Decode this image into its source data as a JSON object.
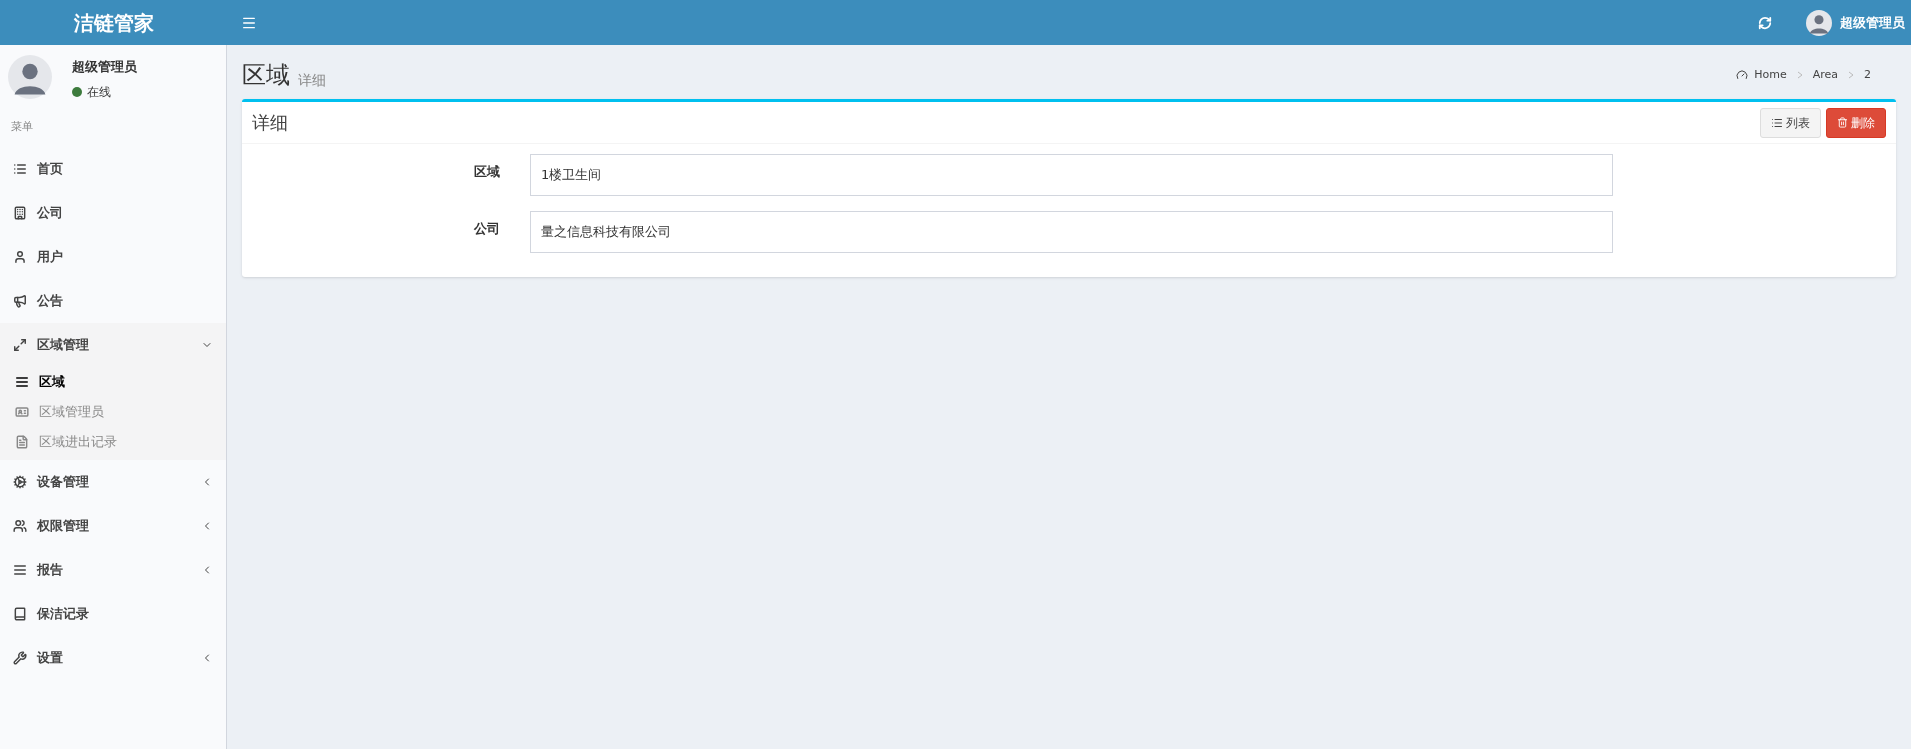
{
  "header": {
    "logo": "洁链管家",
    "user_name": "超级管理员"
  },
  "user_panel": {
    "name": "超级管理员",
    "status": "在线",
    "online": true
  },
  "sidebar": {
    "heading": "菜单",
    "items": [
      {
        "label": "首页",
        "selected": false
      },
      {
        "label": "公司",
        "selected": false
      },
      {
        "label": "用户",
        "selected": false
      },
      {
        "label": "公告",
        "selected": false
      },
      {
        "label": "区域管理",
        "selected": false,
        "expanded": true,
        "children": [
          {
            "label": "区域",
            "selected": true
          },
          {
            "label": "区域管理员",
            "selected": false
          },
          {
            "label": "区域进出记录",
            "selected": false
          }
        ]
      },
      {
        "label": "设备管理",
        "selected": false,
        "expanded": false
      },
      {
        "label": "权限管理",
        "selected": false,
        "expanded": false
      },
      {
        "label": "报告",
        "selected": false,
        "expanded": false
      },
      {
        "label": "保洁记录",
        "selected": false
      },
      {
        "label": "设置",
        "selected": false,
        "expanded": false
      }
    ]
  },
  "page": {
    "title": "区域",
    "subtitle": "详细",
    "breadcrumb": [
      "Home",
      "Area",
      "2"
    ]
  },
  "box": {
    "title": "详细",
    "buttons": [
      {
        "label": "列表",
        "kind": "default"
      },
      {
        "label": "删除",
        "kind": "danger"
      }
    ],
    "fields": [
      {
        "label": "区域",
        "value": "1楼卫生间"
      },
      {
        "label": "公司",
        "value": "量之信息科技有限公司"
      }
    ]
  }
}
